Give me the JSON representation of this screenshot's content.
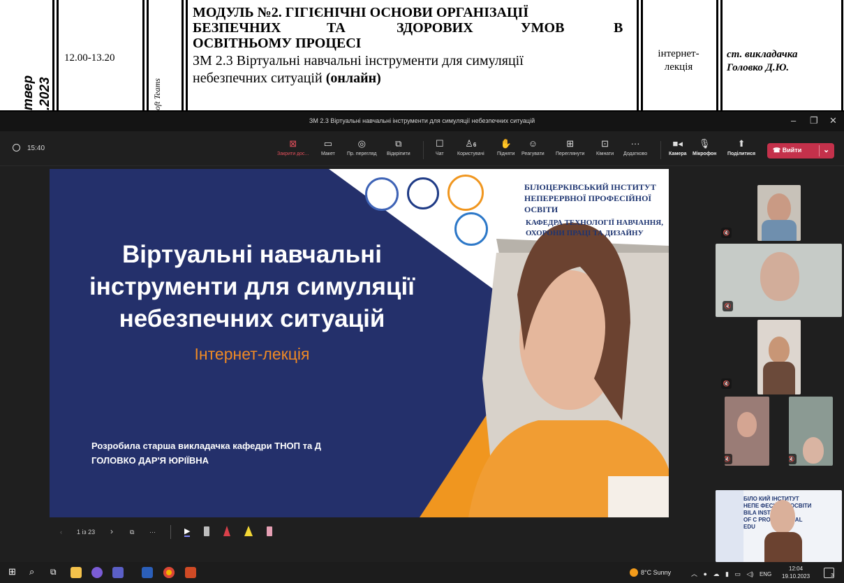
{
  "schedule": {
    "day_fragment": [
      "твер",
      ".2023"
    ],
    "time": "12.00-13.20",
    "platform_fragment": "oft Teams",
    "module_title_lines": [
      "МОДУЛЬ №2. ГІГІЄНІЧНІ ОСНОВИ ОРГАНІЗАЦІЇ",
      "БЕЗПЕЧНИХ ТА ЗДОРОВИХ УМОВ В",
      "ОСВІТНЬОМУ ПРОЦЕСІ"
    ],
    "module_words": [
      "БЕЗПЕЧНИХ",
      "ТА",
      "ЗДОРОВИХ",
      "УМОВ",
      "В"
    ],
    "topic_line1": "ЗМ 2.3 Віртуальні навчальні інструменти для симуляції",
    "topic_line2_plain": "небезпечних ситуацій ",
    "topic_line2_bold": "(онлайн)",
    "format_lines": [
      "інтернет-",
      "лекція"
    ],
    "teacher_lines": [
      "ст. викладачка",
      "Головко Д.Ю."
    ]
  },
  "window": {
    "title": "ЗМ 2.3 Віртуальні навчальні інструменти для симуляції небезпечних ситуацій",
    "minimize": "–",
    "restore": "❐",
    "close": "✕"
  },
  "meeting": {
    "elapsed": "15:40",
    "toolbar": {
      "stop_share": "Закрити дос...",
      "layout": "Макет",
      "preview": "Пр. перегляд",
      "unpin": "Відкріпити",
      "chat": "Чат",
      "people": "Користувачі",
      "people_count": "6",
      "raise": "Підняти",
      "react": "Реагувати",
      "view": "Переглянути",
      "rooms": "Кімнати",
      "more": "Додатково",
      "camera": "Камера",
      "mic": "Мікрофон",
      "share": "Поділитися",
      "leave": "Вийти"
    }
  },
  "slide": {
    "title_lines": [
      "Віртуальні навчальні",
      "інструменти для симуляції",
      "небезпечних ситуацій"
    ],
    "subtitle": "Інтернет-лекція",
    "author_line1": "Розробила старша викладачка кафедри ТНОП та Д",
    "author_line2": "ГОЛОВКО ДАР'Я ЮРІЇВНА",
    "institute_lines": [
      "БІЛОЦЕРКІВСЬКИЙ ІНСТИТУТ",
      "НЕПЕРЕРВНОЇ ПРОФЕСІЙНОЇ ОСВІТИ"
    ],
    "department_lines": [
      "КАФЕДРА ТЕХНОЛОГІЇ НАВЧАННЯ,",
      "ОХОРОНИ ПРАЦІ ТА ДИЗАЙНУ"
    ]
  },
  "presenter_controls": {
    "page_counter": "1 із 23"
  },
  "thumbnail": {
    "lines": [
      "БІЛО  КИЙ ІНСТИТУТ",
      "НЕПЕ  ФЕСІЙНОЇ ОСВІТИ",
      "BILA  INSTITUTE",
      "OF C  PROFESSIONAL",
      "EDU"
    ]
  },
  "taskbar": {
    "weather": "8°C  Sunny",
    "lang": "ENG",
    "time": "12:04",
    "date": "19.10.2023",
    "notifications": "3"
  },
  "colors": {
    "slide_navy": "#24306b",
    "slide_orange": "#f0961f",
    "leave_red": "#c4314b",
    "teams_bg": "#1f1f1f"
  }
}
